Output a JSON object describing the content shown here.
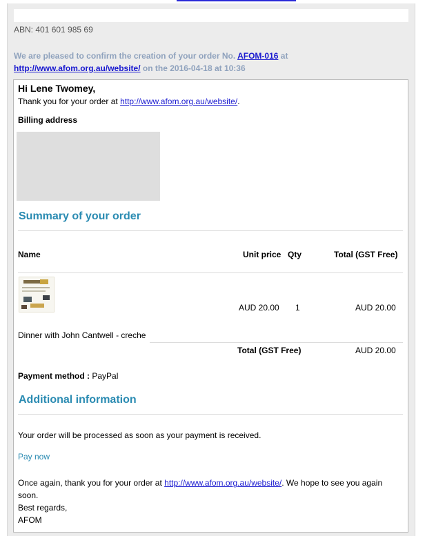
{
  "colors": {
    "accent": "#2a8bb2",
    "link": "#1a1ad0",
    "muted": "#8fa2bd"
  },
  "abn": "ABN: 401 601 985 69",
  "confirm": {
    "prefix": "We are pleased to confirm the creation of your order No.",
    "order_no": "AFOM-016",
    "at": "at",
    "url": "http://www.afom.org.au/website/",
    "suffix": "on the 2016-04-18 at 10:36"
  },
  "greeting": "Hi Lene Twomey,",
  "thanks": {
    "text": "Thank you for your order at",
    "url": "http://www.afom.org.au/website/",
    "end": "."
  },
  "billing": {
    "title": "Billing address"
  },
  "summary": {
    "title": "Summary of your order",
    "headers": {
      "name": "Name",
      "unit_price": "Unit price",
      "qty": "Qty",
      "total": "Total (GST Free)"
    },
    "items": [
      {
        "image": "event-flyer-thumbnail",
        "name": "Dinner with John Cantwell - creche",
        "unit_price": "AUD 20.00",
        "qty": "1",
        "total": "AUD 20.00"
      }
    ],
    "total_label": "Total (GST Free)",
    "total_value": "AUD 20.00"
  },
  "payment": {
    "label": "Payment method :",
    "value": "PayPal"
  },
  "additional": {
    "title": "Additional information",
    "processing": "Your order will be processed as soon as your payment is received.",
    "pay_now": "Pay now"
  },
  "closing": {
    "text_before": "Once again, thank you for your order at",
    "url": "http://www.afom.org.au/website/",
    "text_after": ". We hope to see you again soon.",
    "regards": "Best regards,",
    "signature": "AFOM"
  }
}
